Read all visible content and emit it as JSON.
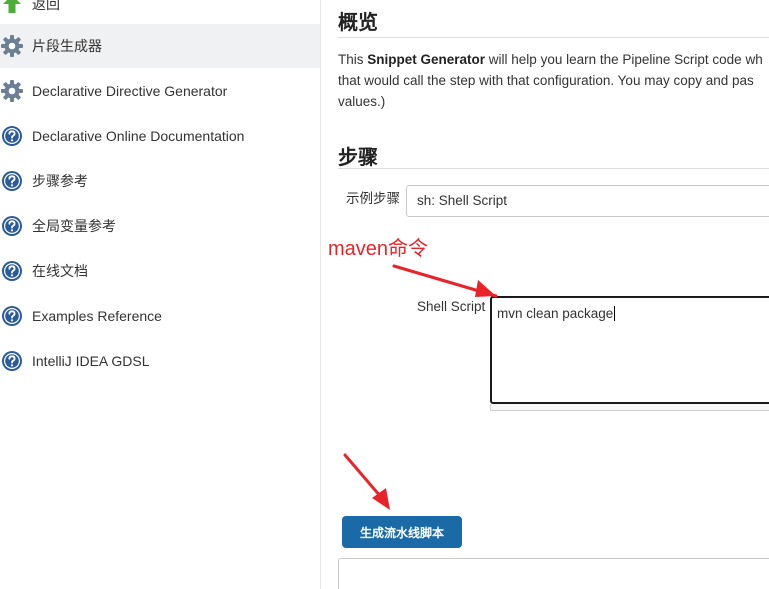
{
  "sidebar": {
    "items": [
      {
        "label": "返回",
        "icon": "up-arrow-icon",
        "active": false
      },
      {
        "label": "片段生成器",
        "icon": "gear-icon",
        "active": true
      },
      {
        "label": "Declarative Directive Generator",
        "icon": "gear-icon",
        "active": false
      },
      {
        "label": "Declarative Online Documentation",
        "icon": "help-icon",
        "active": false
      },
      {
        "label": "步骤参考",
        "icon": "help-icon",
        "active": false
      },
      {
        "label": "全局变量参考",
        "icon": "help-icon",
        "active": false
      },
      {
        "label": "在线文档",
        "icon": "help-icon",
        "active": false
      },
      {
        "label": "Examples Reference",
        "icon": "help-icon",
        "active": false
      },
      {
        "label": "IntelliJ IDEA GDSL",
        "icon": "help-icon",
        "active": false
      }
    ]
  },
  "overview": {
    "title": "概览",
    "desc_line1_pre": "This ",
    "desc_line1_bold": "Snippet Generator",
    "desc_line1_post": " will help you learn the Pipeline Script code wh",
    "desc_line2": "that would call the step with that configuration. You may copy and pas",
    "desc_line3": "values.)"
  },
  "steps": {
    "title": "步骤",
    "sample_step_label": "示例步骤",
    "sample_step_value": "sh: Shell Script",
    "shell_script_label": "Shell Script",
    "shell_script_value": "mvn clean package"
  },
  "generate_button_label": "生成流水线脚本",
  "annotation": {
    "text": "maven命令",
    "color": "#e8242a"
  },
  "colors": {
    "button_bg": "#1a6aa8",
    "active_sidebar_bg": "#f0f1f3",
    "help_icon": "#2b5b9a",
    "gear_icon": "#6b7f95",
    "back_icon": "#4caf35"
  }
}
